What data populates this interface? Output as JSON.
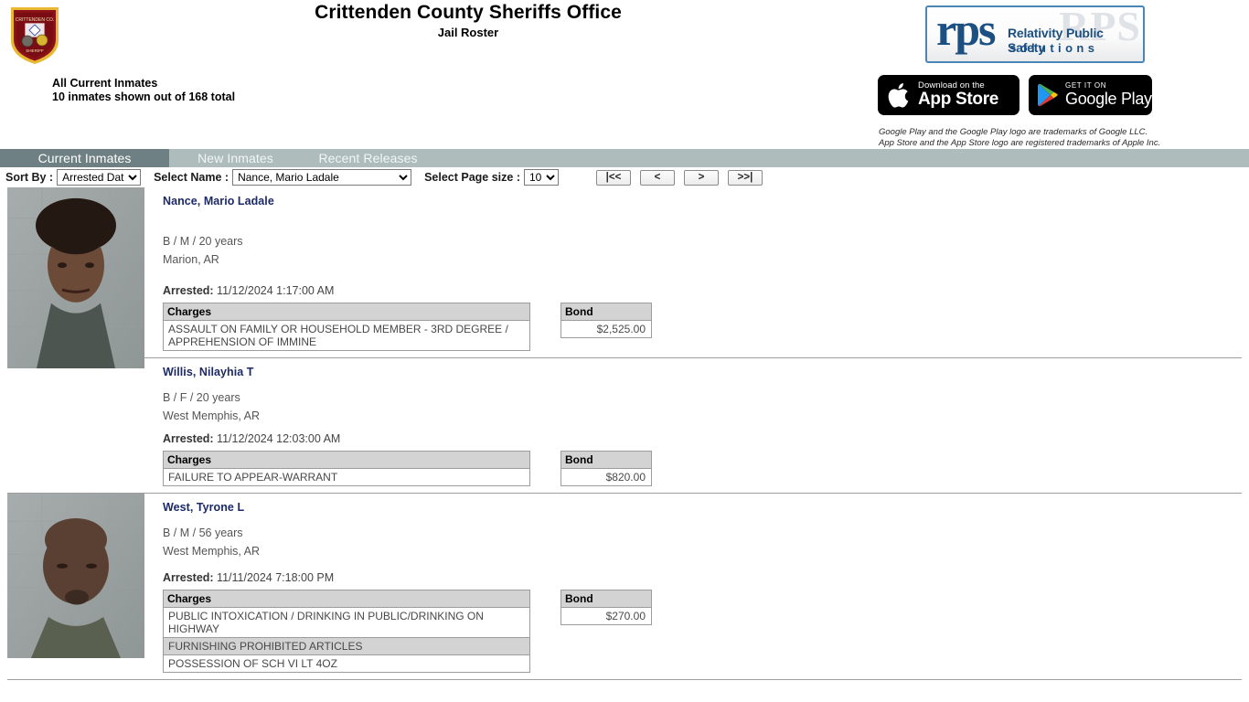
{
  "header": {
    "badge_icon": "sheriff-badge-icon",
    "title": "Crittenden County Sheriffs Office",
    "subtitle": "Jail Roster",
    "status_line1": "All Current Inmates",
    "status_line2": "10 inmates shown out of 168 total",
    "rps": {
      "ghost": "RPS",
      "word": "rps",
      "line1": "Relativity Public Safety",
      "line2": "solutions"
    },
    "app_store": {
      "top": "Download on the",
      "bottom": "App Store",
      "icon": "apple-icon"
    },
    "google_play": {
      "top": "GET IT ON",
      "bottom": "Google Play",
      "icon": "google-play-icon"
    },
    "trademark_line1": "Google Play and the Google Play logo are trademarks of Google LLC.",
    "trademark_line2": "App Store and the App Store logo are registered trademarks of Apple Inc."
  },
  "tabs": [
    {
      "label": "Current Inmates",
      "active": true
    },
    {
      "label": "New Inmates",
      "active": false
    },
    {
      "label": "Recent Releases",
      "active": false
    }
  ],
  "toolbar": {
    "sort_by_label": "Sort By :",
    "sort_by_value": "Arrested Date",
    "sort_by_options": [
      "Arrested Date"
    ],
    "select_name_label": "Select Name :",
    "select_name_value": "Nance, Mario Ladale",
    "select_name_options": [
      "Nance, Mario Ladale"
    ],
    "page_size_label": "Select Page size :",
    "page_size_value": "10",
    "page_size_options": [
      "10"
    ],
    "pager": {
      "first": "|<<",
      "prev": "<",
      "next": ">",
      "last": ">>|"
    }
  },
  "column_headers": {
    "charges": "Charges",
    "bond": "Bond"
  },
  "inmates": [
    {
      "name": "Nance, Mario Ladale",
      "demographics": "B / M / 20 years",
      "city": "Marion, AR",
      "arrested_label": "Arrested:",
      "arrested_value": "11/12/2024 1:17:00 AM",
      "has_photo": true,
      "photo_height": 198,
      "charges": [
        "ASSAULT ON FAMILY OR HOUSEHOLD MEMBER - 3RD DEGREE / APPREHENSION OF IMMINE"
      ],
      "bonds": [
        "$2,525.00"
      ]
    },
    {
      "name": "Willis, Nilayhia T",
      "demographics": "B / F / 20 years",
      "city": "West Memphis, AR",
      "arrested_label": "Arrested:",
      "arrested_value": "11/12/2024 12:03:00 AM",
      "has_photo": false,
      "photo_height": 0,
      "charges": [
        "FAILURE TO APPEAR-WARRANT"
      ],
      "bonds": [
        "$820.00"
      ]
    },
    {
      "name": "West, Tyrone L",
      "demographics": "B / M / 56 years",
      "city": "West Memphis, AR",
      "arrested_label": "Arrested:",
      "arrested_value": "11/11/2024 7:18:00 PM",
      "has_photo": true,
      "photo_height": 180,
      "charges": [
        "PUBLIC INTOXICATION / DRINKING IN PUBLIC/DRINKING ON HIGHWAY",
        "FURNISHING PROHIBITED ARTICLES",
        "POSSESSION OF SCH VI LT 4OZ"
      ],
      "bonds": [
        "$270.00"
      ]
    }
  ],
  "colors": {
    "tab_bar": "#aebcbc",
    "tab_active": "#6e8083",
    "name_link": "#1d2a66",
    "table_header": "#d3d3d3",
    "rps_blue": "#1c4f82"
  }
}
